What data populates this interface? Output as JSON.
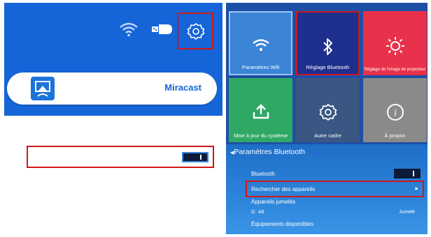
{
  "left_top": {
    "status_icons": [
      "wifi-icon",
      "usb-icon",
      "gear-icon"
    ],
    "miracast_label": "Miracast"
  },
  "tiles": [
    {
      "label": "Paramètres Wifi",
      "icon": "wifi-icon",
      "color": "#3b84d6"
    },
    {
      "label": "Réglage Bluetooth",
      "icon": "bluetooth-icon",
      "color": "#1e2f8e"
    },
    {
      "label": "Réglage de l'image de projecteur",
      "icon": "sun-icon",
      "color": "#e8314a"
    },
    {
      "label": "Mise à jour du système",
      "icon": "upload-icon",
      "color": "#2fa866"
    },
    {
      "label": "Autre cadre",
      "icon": "gear-icon",
      "color": "#3a5682"
    },
    {
      "label": "À propos",
      "icon": "info-icon",
      "color": "#8a8a8a"
    }
  ],
  "bluetooth": {
    "title": "Paramètres Bluetooth",
    "toggle_label": "Bluetooth",
    "search_label": "Rechercher des appareils",
    "paired_label": "Appareils jumelés",
    "device_name": "A6",
    "device_status": "Jumelé",
    "available_label": "Équipements disponibles"
  },
  "colors": {
    "accent_blue": "#1565d8",
    "highlight_red": "#d01818"
  }
}
